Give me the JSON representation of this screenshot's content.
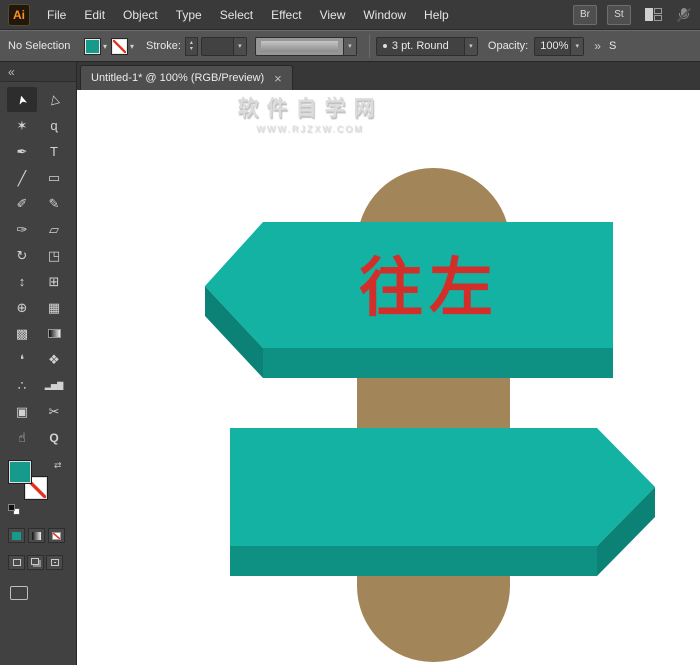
{
  "app": {
    "logo_text": "Ai",
    "menu_items": [
      "File",
      "Edit",
      "Object",
      "Type",
      "Select",
      "Effect",
      "View",
      "Window",
      "Help"
    ],
    "topbar_buttons": [
      "Br",
      "St"
    ]
  },
  "control_bar": {
    "selection_status": "No Selection",
    "stroke_label": "Stroke:",
    "stroke_weight_value": "",
    "brush_value": "3 pt. Round",
    "opacity_label": "Opacity:",
    "opacity_value": "100%",
    "truncated_panel_label": "S"
  },
  "document_tab": {
    "title": "Untitled-1* @ 100% (RGB/Preview)",
    "close_glyph": "×"
  },
  "icons": {
    "chevron_down": "▾",
    "stepper_up": "▴",
    "stepper_down": "▾",
    "swap_colors": "⇄",
    "collapse_panel": "«",
    "overflow_chevron": "»"
  },
  "tools_panel": {
    "tools": [
      {
        "name": "selection-tool",
        "glyph": "➤",
        "selected": true
      },
      {
        "name": "direct-selection-tool",
        "glyph": "▷",
        "selected": false
      },
      {
        "name": "magic-wand-tool",
        "glyph": "✶",
        "selected": false
      },
      {
        "name": "lasso-tool",
        "glyph": "ɋ",
        "selected": false
      },
      {
        "name": "pen-tool",
        "glyph": "✒",
        "selected": false
      },
      {
        "name": "type-tool",
        "glyph": "T",
        "selected": false
      },
      {
        "name": "line-segment-tool",
        "glyph": "╱",
        "selected": false
      },
      {
        "name": "rectangle-tool",
        "glyph": "▭",
        "selected": false
      },
      {
        "name": "paintbrush-tool",
        "glyph": "✐",
        "selected": false
      },
      {
        "name": "pencil-tool",
        "glyph": "✎",
        "selected": false
      },
      {
        "name": "blob-brush-tool",
        "glyph": "✑",
        "selected": false
      },
      {
        "name": "eraser-tool",
        "glyph": "▱",
        "selected": false
      },
      {
        "name": "rotate-tool",
        "glyph": "↻",
        "selected": false
      },
      {
        "name": "scale-tool",
        "glyph": "◳",
        "selected": false
      },
      {
        "name": "width-tool",
        "glyph": "↕",
        "selected": false
      },
      {
        "name": "free-transform-tool",
        "glyph": "⊞",
        "selected": false
      },
      {
        "name": "shape-builder-tool",
        "glyph": "⊕",
        "selected": false
      },
      {
        "name": "perspective-grid-tool",
        "glyph": "▦",
        "selected": false
      },
      {
        "name": "mesh-tool",
        "glyph": "▩",
        "selected": false
      },
      {
        "name": "gradient-tool",
        "glyph": "",
        "selected": false
      },
      {
        "name": "eyedropper-tool",
        "glyph": "❛",
        "selected": false
      },
      {
        "name": "blend-tool",
        "glyph": "❖",
        "selected": false
      },
      {
        "name": "symbol-sprayer-tool",
        "glyph": "∴",
        "selected": false
      },
      {
        "name": "column-graph-tool",
        "glyph": "▂▅▇",
        "selected": false
      },
      {
        "name": "artboard-tool",
        "glyph": "▣",
        "selected": false
      },
      {
        "name": "slice-tool",
        "glyph": "✂",
        "selected": false
      },
      {
        "name": "hand-tool",
        "glyph": "☝",
        "selected": false
      },
      {
        "name": "zoom-tool",
        "glyph": "Q",
        "selected": false
      }
    ]
  },
  "canvas": {
    "watermark_line1": "软件自学网",
    "watermark_line2": "WWW.RJZXW.COM",
    "sign_text": "往左"
  },
  "colors": {
    "fill_teal": "#169a8b",
    "sign_face": "#13b2a2",
    "sign_side": "#0e9083",
    "sign_tip": "#0c8277",
    "post_brown": "#a28559",
    "text_red": "#d22f2b",
    "none_red": "#e0311f"
  }
}
